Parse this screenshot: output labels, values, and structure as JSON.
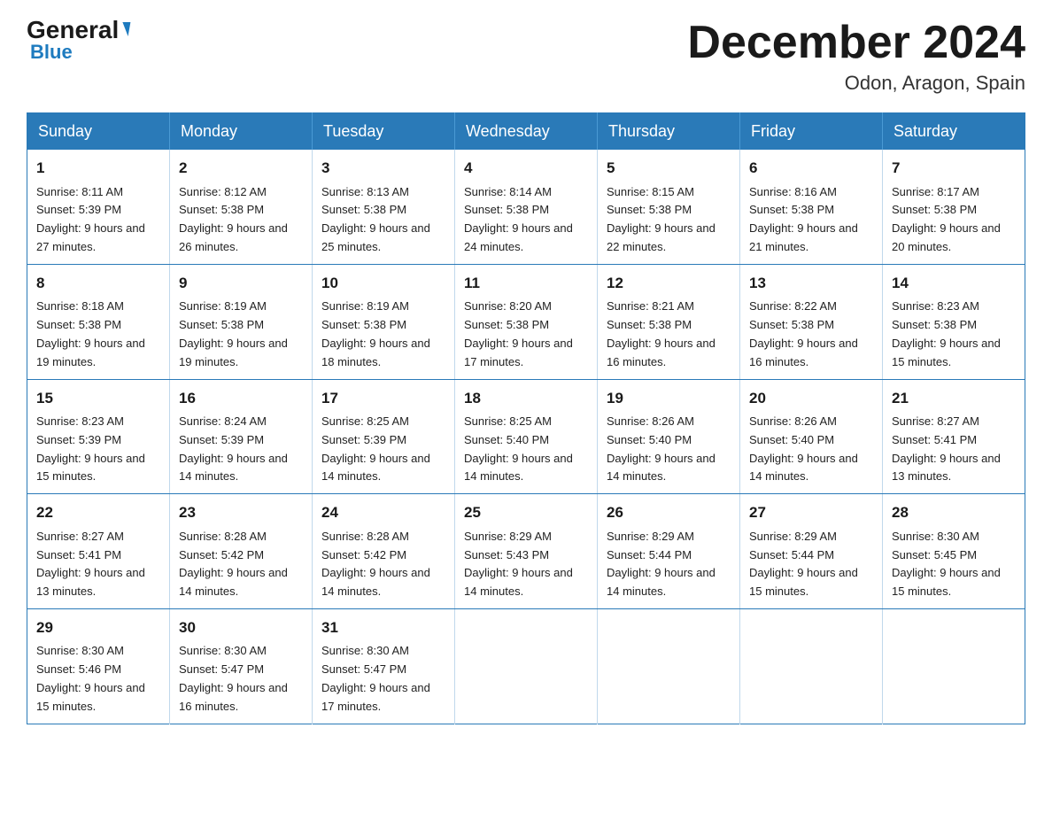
{
  "logo": {
    "general": "General",
    "arrow": "▶",
    "blue_line1": "",
    "blue_line2": "Blue"
  },
  "header": {
    "title": "December 2024",
    "subtitle": "Odon, Aragon, Spain"
  },
  "weekdays": [
    "Sunday",
    "Monday",
    "Tuesday",
    "Wednesday",
    "Thursday",
    "Friday",
    "Saturday"
  ],
  "weeks": [
    [
      {
        "day": "1",
        "sunrise": "8:11 AM",
        "sunset": "5:39 PM",
        "daylight": "9 hours and 27 minutes."
      },
      {
        "day": "2",
        "sunrise": "8:12 AM",
        "sunset": "5:38 PM",
        "daylight": "9 hours and 26 minutes."
      },
      {
        "day": "3",
        "sunrise": "8:13 AM",
        "sunset": "5:38 PM",
        "daylight": "9 hours and 25 minutes."
      },
      {
        "day": "4",
        "sunrise": "8:14 AM",
        "sunset": "5:38 PM",
        "daylight": "9 hours and 24 minutes."
      },
      {
        "day": "5",
        "sunrise": "8:15 AM",
        "sunset": "5:38 PM",
        "daylight": "9 hours and 22 minutes."
      },
      {
        "day": "6",
        "sunrise": "8:16 AM",
        "sunset": "5:38 PM",
        "daylight": "9 hours and 21 minutes."
      },
      {
        "day": "7",
        "sunrise": "8:17 AM",
        "sunset": "5:38 PM",
        "daylight": "9 hours and 20 minutes."
      }
    ],
    [
      {
        "day": "8",
        "sunrise": "8:18 AM",
        "sunset": "5:38 PM",
        "daylight": "9 hours and 19 minutes."
      },
      {
        "day": "9",
        "sunrise": "8:19 AM",
        "sunset": "5:38 PM",
        "daylight": "9 hours and 19 minutes."
      },
      {
        "day": "10",
        "sunrise": "8:19 AM",
        "sunset": "5:38 PM",
        "daylight": "9 hours and 18 minutes."
      },
      {
        "day": "11",
        "sunrise": "8:20 AM",
        "sunset": "5:38 PM",
        "daylight": "9 hours and 17 minutes."
      },
      {
        "day": "12",
        "sunrise": "8:21 AM",
        "sunset": "5:38 PM",
        "daylight": "9 hours and 16 minutes."
      },
      {
        "day": "13",
        "sunrise": "8:22 AM",
        "sunset": "5:38 PM",
        "daylight": "9 hours and 16 minutes."
      },
      {
        "day": "14",
        "sunrise": "8:23 AM",
        "sunset": "5:38 PM",
        "daylight": "9 hours and 15 minutes."
      }
    ],
    [
      {
        "day": "15",
        "sunrise": "8:23 AM",
        "sunset": "5:39 PM",
        "daylight": "9 hours and 15 minutes."
      },
      {
        "day": "16",
        "sunrise": "8:24 AM",
        "sunset": "5:39 PM",
        "daylight": "9 hours and 14 minutes."
      },
      {
        "day": "17",
        "sunrise": "8:25 AM",
        "sunset": "5:39 PM",
        "daylight": "9 hours and 14 minutes."
      },
      {
        "day": "18",
        "sunrise": "8:25 AM",
        "sunset": "5:40 PM",
        "daylight": "9 hours and 14 minutes."
      },
      {
        "day": "19",
        "sunrise": "8:26 AM",
        "sunset": "5:40 PM",
        "daylight": "9 hours and 14 minutes."
      },
      {
        "day": "20",
        "sunrise": "8:26 AM",
        "sunset": "5:40 PM",
        "daylight": "9 hours and 14 minutes."
      },
      {
        "day": "21",
        "sunrise": "8:27 AM",
        "sunset": "5:41 PM",
        "daylight": "9 hours and 13 minutes."
      }
    ],
    [
      {
        "day": "22",
        "sunrise": "8:27 AM",
        "sunset": "5:41 PM",
        "daylight": "9 hours and 13 minutes."
      },
      {
        "day": "23",
        "sunrise": "8:28 AM",
        "sunset": "5:42 PM",
        "daylight": "9 hours and 14 minutes."
      },
      {
        "day": "24",
        "sunrise": "8:28 AM",
        "sunset": "5:42 PM",
        "daylight": "9 hours and 14 minutes."
      },
      {
        "day": "25",
        "sunrise": "8:29 AM",
        "sunset": "5:43 PM",
        "daylight": "9 hours and 14 minutes."
      },
      {
        "day": "26",
        "sunrise": "8:29 AM",
        "sunset": "5:44 PM",
        "daylight": "9 hours and 14 minutes."
      },
      {
        "day": "27",
        "sunrise": "8:29 AM",
        "sunset": "5:44 PM",
        "daylight": "9 hours and 15 minutes."
      },
      {
        "day": "28",
        "sunrise": "8:30 AM",
        "sunset": "5:45 PM",
        "daylight": "9 hours and 15 minutes."
      }
    ],
    [
      {
        "day": "29",
        "sunrise": "8:30 AM",
        "sunset": "5:46 PM",
        "daylight": "9 hours and 15 minutes."
      },
      {
        "day": "30",
        "sunrise": "8:30 AM",
        "sunset": "5:47 PM",
        "daylight": "9 hours and 16 minutes."
      },
      {
        "day": "31",
        "sunrise": "8:30 AM",
        "sunset": "5:47 PM",
        "daylight": "9 hours and 17 minutes."
      },
      null,
      null,
      null,
      null
    ]
  ]
}
